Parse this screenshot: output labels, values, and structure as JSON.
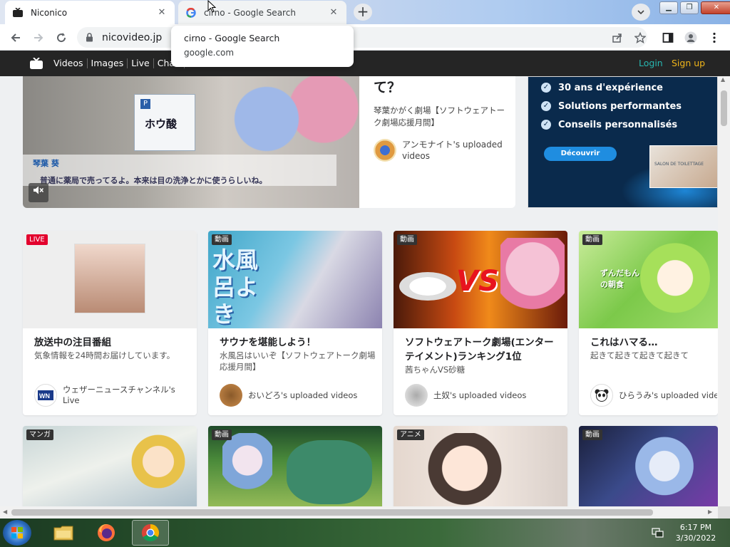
{
  "browser": {
    "tabs": [
      {
        "title": "Niconico",
        "active": true
      },
      {
        "title": "cirno - Google Search",
        "active": false
      }
    ],
    "url": "nicovideo.jp",
    "tooltip": {
      "title": "cirno - Google Search",
      "domain": "google.com"
    }
  },
  "site_nav": {
    "links": [
      "Videos",
      "Images",
      "Live",
      "Chan"
    ],
    "login": "Login",
    "signup": "Sign up"
  },
  "hero": {
    "title": "て？",
    "subtitle": "琴葉かがく劇場【ソフトウェアトーク劇場応援月間】",
    "user": "アンモナイト's uploaded videos",
    "video_box_label": "ホウ酸",
    "video_box_badge": "P",
    "subtitle_name": "琴葉 葵",
    "subtitle_line": "普通に薬局で売ってるよ。本来は目の洗浄とかに使うらしいね。"
  },
  "ad": {
    "features": [
      "30 ans d'expérience",
      "Solutions performantes",
      "Conseils personnalisés"
    ],
    "cta": "Découvrir",
    "pic_text": "SALON DE TOILETTAGE"
  },
  "cards": [
    {
      "badge": "LIVE",
      "title": "放送中の注目番組",
      "desc": "気象情報を24時間お届けしています。",
      "user": "ウェザーニュースチャンネル's Live"
    },
    {
      "badge": "動画",
      "title": "サウナを堪能しよう！",
      "desc": "水風呂はいいぞ【ソフトウェアトーク劇場応援月間】",
      "user": "おいどろ's uploaded videos",
      "thumb_text": "水風呂よき"
    },
    {
      "badge": "動画",
      "title": "ソフトウェアトーク劇場(エンターテイメント)ランキング1位",
      "desc": "茜ちゃんVS砂糖",
      "user": "土奴's uploaded videos",
      "thumb_text": "VS"
    },
    {
      "badge": "動画",
      "title": "これはハマる…",
      "desc": "起きて起きて起きて起きて",
      "user": "ひらうみ's uploaded vide",
      "thumb_text": "ずんだもんの朝食"
    }
  ],
  "cards_row2": [
    {
      "badge": "マンガ"
    },
    {
      "badge": "動画"
    },
    {
      "badge": "アニメ"
    },
    {
      "badge": "動画"
    }
  ],
  "taskbar": {
    "time": "6:17 PM",
    "date": "3/30/2022"
  }
}
